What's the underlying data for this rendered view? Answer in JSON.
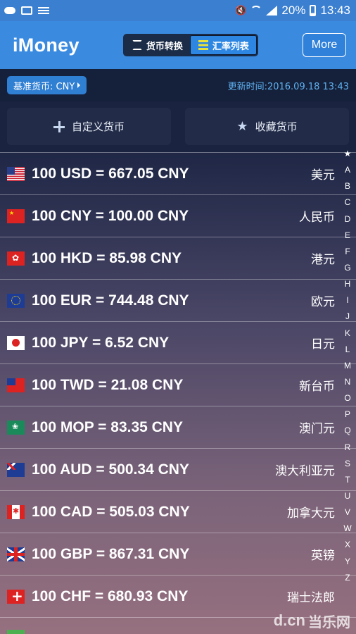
{
  "status_bar": {
    "battery_percent": "20%",
    "time": "13:43",
    "left_icons": [
      "cloud-icon",
      "image-icon",
      "list-icon"
    ],
    "right_icons": [
      "mute-icon",
      "wifi-icon",
      "signal-icon",
      "battery-icon"
    ]
  },
  "app_bar": {
    "title": "iMoney",
    "tabs": [
      {
        "label": "货币转换",
        "icon": "swap-icon",
        "active": false
      },
      {
        "label": "汇率列表",
        "icon": "list-bars-icon",
        "active": true
      }
    ],
    "more_label": "More"
  },
  "info_bar": {
    "base_currency_label": "基准货币: CNY",
    "update_time": "更新时间:2016.09.18 13:43"
  },
  "actions": {
    "custom_label": "自定义货币",
    "favorites_label": "收藏货币"
  },
  "rates": [
    {
      "text": "100 USD = 667.05 CNY",
      "name": "美元",
      "flag": "us"
    },
    {
      "text": "100 CNY = 100.00 CNY",
      "name": "人民币",
      "flag": "cn"
    },
    {
      "text": "100 HKD = 85.98 CNY",
      "name": "港元",
      "flag": "hk"
    },
    {
      "text": "100 EUR = 744.48 CNY",
      "name": "欧元",
      "flag": "eu"
    },
    {
      "text": "100 JPY = 6.52 CNY",
      "name": "日元",
      "flag": "jp"
    },
    {
      "text": "100 TWD = 21.08 CNY",
      "name": "新台币",
      "flag": "tw"
    },
    {
      "text": "100 MOP = 83.35 CNY",
      "name": "澳门元",
      "flag": "mo"
    },
    {
      "text": "100 AUD = 500.34 CNY",
      "name": "澳大利亚元",
      "flag": "au"
    },
    {
      "text": "100 CAD = 505.03 CNY",
      "name": "加拿大元",
      "flag": "ca"
    },
    {
      "text": "100 GBP = 867.31 CNY",
      "name": "英镑",
      "flag": "gb"
    },
    {
      "text": "100 CHF = 680.93 CNY",
      "name": "瑞士法郎",
      "flag": "ch"
    }
  ],
  "index_letters": [
    "★",
    "A",
    "B",
    "C",
    "D",
    "E",
    "F",
    "G",
    "H",
    "I",
    "J",
    "K",
    "L",
    "M",
    "N",
    "O",
    "P",
    "Q",
    "R",
    "S",
    "T",
    "U",
    "V",
    "W",
    "X",
    "Y",
    "Z"
  ],
  "watermark": {
    "text": "d.cn",
    "cn": "当乐网"
  }
}
